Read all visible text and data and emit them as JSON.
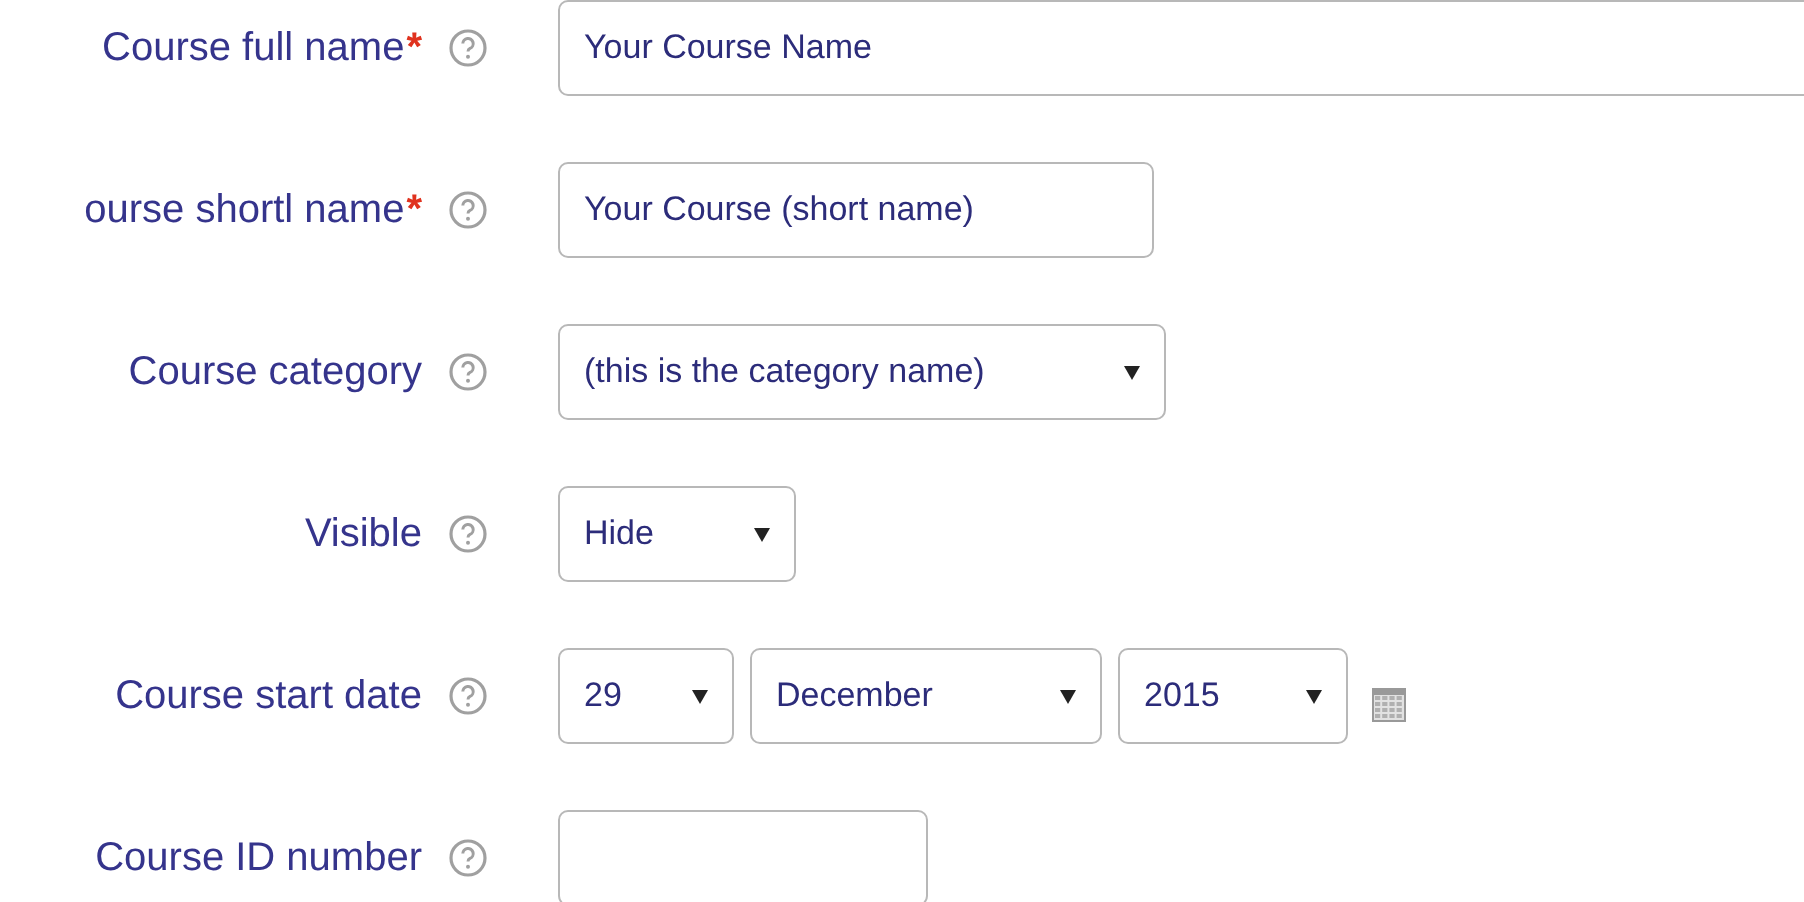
{
  "fields": [
    {
      "kind": "text",
      "label": "Course full name",
      "required_mark": "*",
      "value": "Your Course Name"
    },
    {
      "kind": "text",
      "label": "ourse shortl name",
      "required_mark": "*",
      "value": "Your Course (short name)"
    },
    {
      "kind": "select",
      "label": "Course category",
      "value": "(this is the category name)"
    },
    {
      "kind": "select",
      "label": "Visible",
      "value": "Hide"
    },
    {
      "kind": "date",
      "label": "Course start date",
      "day": "29",
      "month": "December",
      "year": "2015"
    },
    {
      "kind": "text",
      "label": "Course ID number"
    }
  ]
}
